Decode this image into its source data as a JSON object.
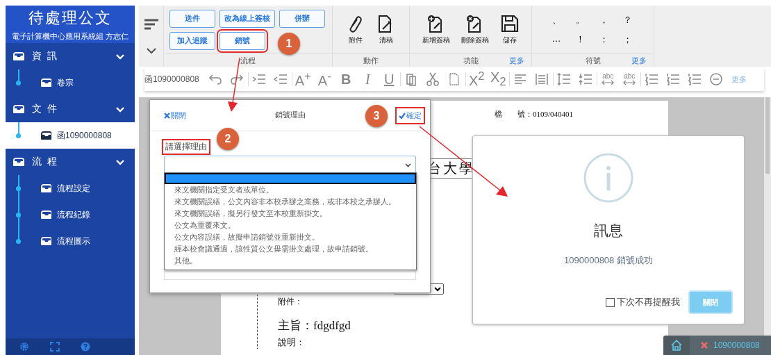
{
  "sidebar": {
    "title": "待處理公文",
    "subtitle": "電子計算機中心應用系統組 方志仁",
    "sections": [
      {
        "label": "資 訊",
        "expanded": true,
        "children": [
          {
            "label": "卷宗",
            "selected": false
          }
        ]
      },
      {
        "label": "文 件",
        "expanded": true,
        "children": [
          {
            "label": "函1090000808",
            "selected": true
          }
        ]
      },
      {
        "label": "流 程",
        "expanded": true,
        "children": [
          {
            "label": "流程設定",
            "selected": false
          },
          {
            "label": "流程紀錄",
            "selected": false
          },
          {
            "label": "流程圖示",
            "selected": false
          }
        ]
      }
    ]
  },
  "ribbon": {
    "flow": {
      "label": "流程",
      "rows": [
        [
          {
            "label": "送件",
            "highlighted": false
          },
          {
            "label": "改為線上簽核",
            "highlighted": false
          },
          {
            "label": "併辦",
            "highlighted": false
          }
        ],
        [
          {
            "label": "加入追蹤",
            "highlighted": false
          },
          {
            "label": "銷號",
            "highlighted": true
          }
        ]
      ]
    },
    "actions": {
      "label": "動作",
      "items": [
        "附件",
        "清稿"
      ]
    },
    "functions": {
      "label": "功能",
      "items": [
        "新增簽稿",
        "刪除簽稿",
        "儲存"
      ],
      "more": "更多"
    },
    "symbols": {
      "label": "符號",
      "items": [
        "、",
        "。",
        "，",
        "？",
        "…",
        "！",
        "：",
        "；"
      ],
      "more": "更多"
    }
  },
  "format_toolbar": {
    "doc_title": "函1090000808",
    "glyphs": [
      "A$^{+}$",
      "A$^{-}$",
      "B",
      "I",
      "U",
      "X$^{2}$",
      "X$_{2}$",
      "abc",
      "abc"
    ],
    "more": "更多"
  },
  "document": {
    "file_number": "檔　　號：0109/040401",
    "letterhead": "台大學",
    "attachment": "附件：",
    "subject": "主旨：fdgdfgd",
    "explanation": "說明："
  },
  "reason_dialog": {
    "close": "關閉",
    "title": "銷號理由",
    "confirm": "確定",
    "confirm_highlighted": true,
    "field_label": "請選擇理由",
    "label_highlighted": true,
    "blank_option_selected": true,
    "options": [
      "來文機關指定受文者或單位。",
      "來文機關誤繕，公文內容非本校承辦之業務，或非本校之承辦人。",
      "來文機關誤繕，擬另行發文至本校重新掛文。",
      "公文為重覆來文。",
      "公文內容誤繕，故擬申請銷號並重新掛文。",
      "經本校會議通過，該性質公文毋需掛文處理，故申請銷號。",
      "其他。"
    ]
  },
  "message_dialog": {
    "title": "訊息",
    "message": "1090000808 銷號成功",
    "dont_remind": {
      "label": "下次不再提醒我",
      "checked": false
    },
    "close": "關閉"
  },
  "tabs": [
    {
      "label": "1090000808",
      "selected": true
    }
  ],
  "steps": [
    "1",
    "2",
    "3"
  ]
}
